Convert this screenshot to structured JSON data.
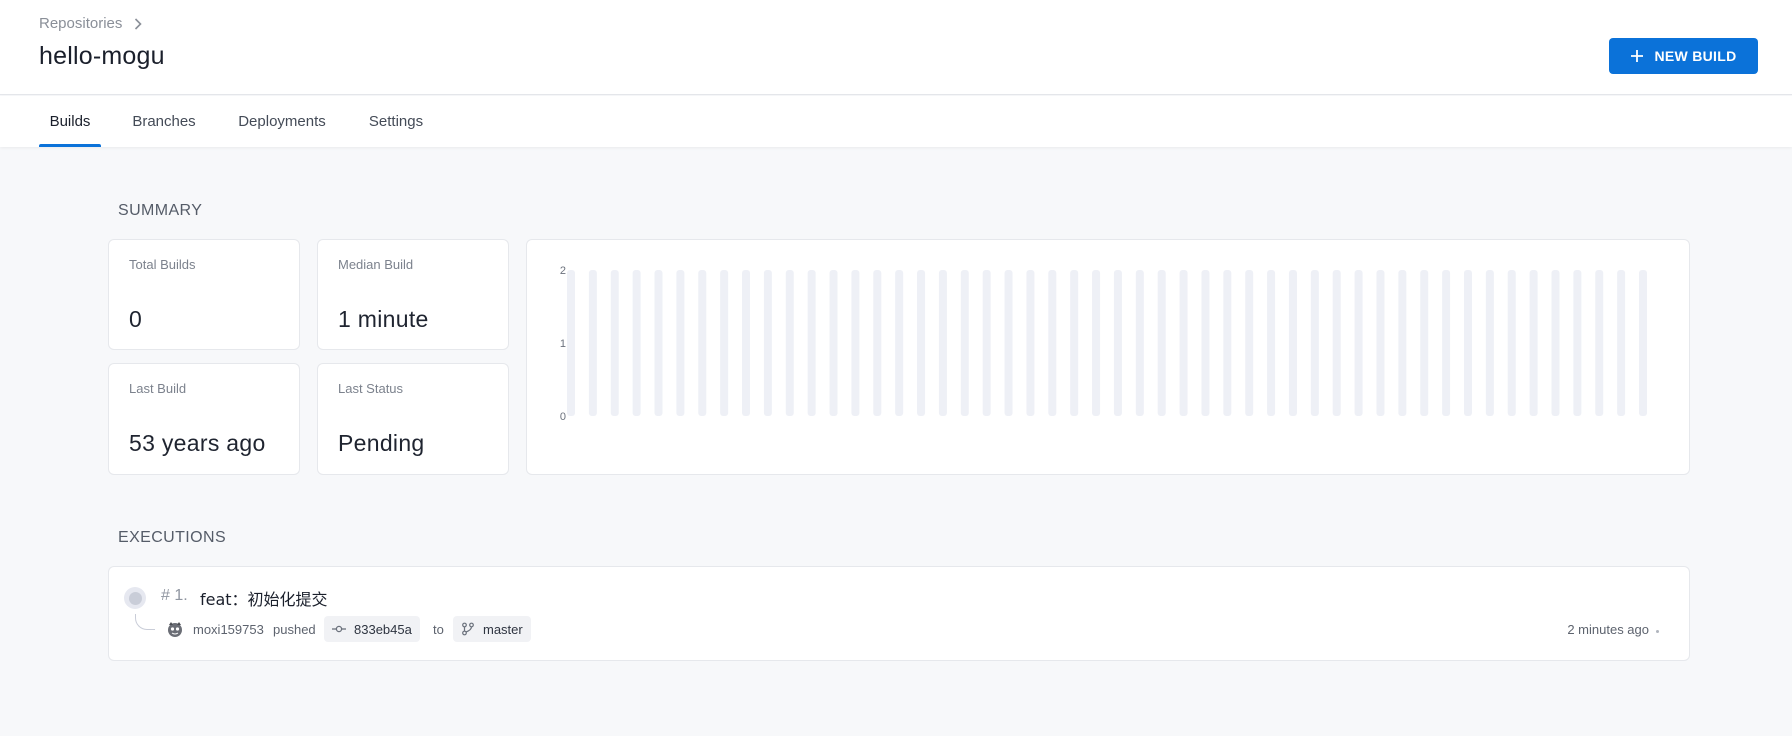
{
  "breadcrumb": {
    "label": "Repositories"
  },
  "page": {
    "title": "hello-mogu"
  },
  "actions": {
    "new_build_label": "NEW BUILD"
  },
  "tabs": [
    {
      "label": "Builds",
      "active": true
    },
    {
      "label": "Branches",
      "active": false
    },
    {
      "label": "Deployments",
      "active": false
    },
    {
      "label": "Settings",
      "active": false
    }
  ],
  "summary": {
    "title": "SUMMARY",
    "cards": [
      {
        "label": "Total Builds",
        "value": "0"
      },
      {
        "label": "Median Build",
        "value": "1 minute"
      },
      {
        "label": "Last Build",
        "value": "53 years ago"
      },
      {
        "label": "Last Status",
        "value": "Pending"
      }
    ]
  },
  "chart_data": {
    "type": "bar",
    "y_ticks": [
      "2",
      "1",
      "0"
    ],
    "ylim": [
      0,
      2
    ],
    "bar_count": 50,
    "values": [
      0,
      0,
      0,
      0,
      0,
      0,
      0,
      0,
      0,
      0,
      0,
      0,
      0,
      0,
      0,
      0,
      0,
      0,
      0,
      0,
      0,
      0,
      0,
      0,
      0,
      0,
      0,
      0,
      0,
      0,
      0,
      0,
      0,
      0,
      0,
      0,
      0,
      0,
      0,
      0,
      0,
      0,
      0,
      0,
      0,
      0,
      0,
      0,
      0,
      0
    ],
    "title": "",
    "xlabel": "",
    "ylabel": "",
    "bar_track_color": "#eef0f6"
  },
  "executions": {
    "title": "EXECUTIONS",
    "items": [
      {
        "number": "# 1.",
        "message": "feat：初始化提交",
        "author": "moxi159753",
        "action": "pushed",
        "commit": "833eb45a",
        "connector": "to",
        "branch": "master",
        "time": "2 minutes ago"
      }
    ]
  },
  "colors": {
    "accent": "#0b72d9",
    "background": "#f7f8fa"
  }
}
